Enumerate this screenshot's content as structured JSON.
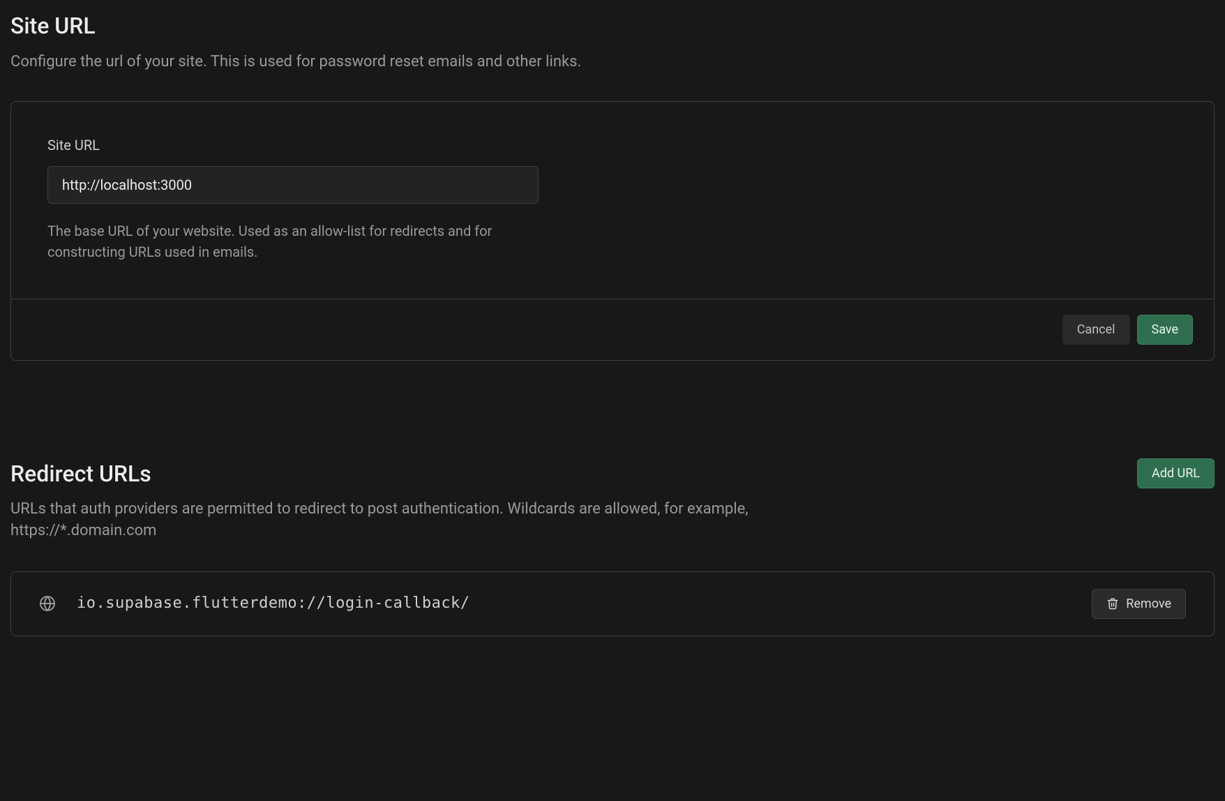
{
  "siteUrlSection": {
    "title": "Site URL",
    "description": "Configure the url of your site. This is used for password reset emails and other links.",
    "field": {
      "label": "Site URL",
      "value": "http://localhost:3000",
      "help": "The base URL of your website. Used as an allow-list for redirects and for constructing URLs used in emails."
    },
    "actions": {
      "cancel": "Cancel",
      "save": "Save"
    }
  },
  "redirectSection": {
    "title": "Redirect URLs",
    "description": "URLs that auth providers are permitted to redirect to post authentication. Wildcards are allowed, for example, https://*.domain.com",
    "addButton": "Add URL",
    "items": [
      {
        "url": "io.supabase.flutterdemo://login-callback/",
        "removeLabel": "Remove"
      }
    ]
  }
}
